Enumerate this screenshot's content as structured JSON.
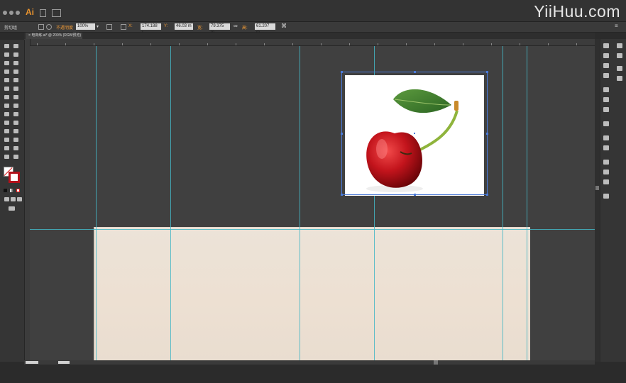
{
  "app": {
    "logo": "Ai",
    "watermark": "YiiHuu.com"
  },
  "controlbar": {
    "selection_label": "剪切组",
    "opacity_label": "不透明度",
    "opacity_value": "100%",
    "x_label": "X:",
    "x_value": "174.188 r",
    "y_label": "Y:",
    "y_value": "46.03 m",
    "w_label": "宽:",
    "w_value": "79.375 m",
    "h_label": "高:",
    "h_value": "61.207 m"
  },
  "document": {
    "tab_label": "电商练.ai* @ 200% (RGB/预览)",
    "zoom": "200%"
  },
  "colors": {
    "guide": "#44b6c6",
    "selection": "#4a7ad8",
    "accent": "#f09a36",
    "paper": "#ece3d8",
    "cherry": "#b3111b",
    "leaf": "#3f7a2e"
  },
  "icons": {
    "app_logo": "ai-logo-icon",
    "close": "close-icon",
    "link": "link-icon"
  }
}
